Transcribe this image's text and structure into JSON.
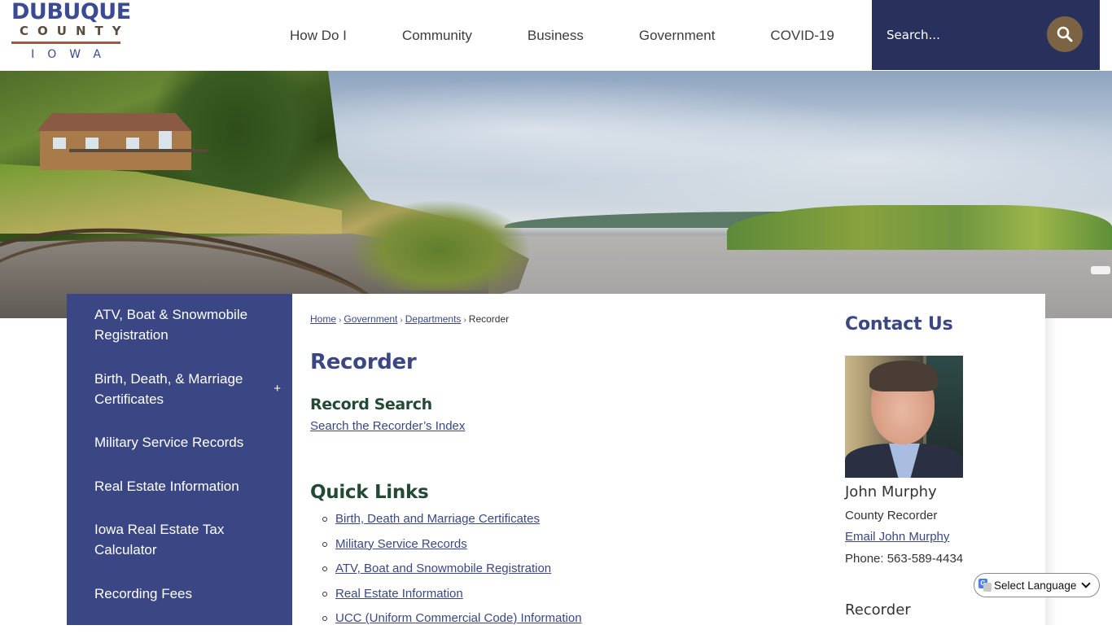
{
  "header": {
    "logo": {
      "line1": "DUBUQUE",
      "line2": "COUNTY",
      "line3": "IOWA"
    },
    "nav": [
      {
        "label": "How Do I"
      },
      {
        "label": "Community"
      },
      {
        "label": "Business"
      },
      {
        "label": "Government"
      },
      {
        "label": "COVID-19"
      }
    ],
    "search": {
      "placeholder": "Search...",
      "button_icon": "search-icon"
    }
  },
  "sidebar": {
    "items": [
      {
        "label": "ATV, Boat & Snowmobile Registration",
        "expandable": false
      },
      {
        "label": "Birth, Death, & Marriage Certificates",
        "expandable": true,
        "expand_symbol": "+"
      },
      {
        "label": "Military Service Records",
        "expandable": false
      },
      {
        "label": "Real Estate Information",
        "expandable": false
      },
      {
        "label": "Iowa Real Estate Tax Calculator",
        "expandable": false
      },
      {
        "label": "Recording Fees",
        "expandable": false
      }
    ]
  },
  "breadcrumb": {
    "items": [
      {
        "label": "Home",
        "link": true
      },
      {
        "label": "Government",
        "link": true
      },
      {
        "label": "Departments",
        "link": true
      },
      {
        "label": "Recorder",
        "link": false
      }
    ],
    "separator": "›"
  },
  "main": {
    "title": "Recorder",
    "record_search": {
      "heading": "Record Search",
      "link": "Search the Recorder’s Index"
    },
    "quick_links": {
      "heading": "Quick Links",
      "items": [
        "Birth, Death and Marriage Certificates",
        "Military Service Records",
        "ATV, Boat and Snowmobile Registration",
        "Real Estate Information",
        "UCC (Uniform Commercial Code) Information"
      ]
    }
  },
  "contact": {
    "heading": "Contact Us",
    "name": "John Murphy",
    "role": "County Recorder",
    "email_link": "Email John Murphy",
    "phone": "Phone: 563-589-4434",
    "sub_heading": "Recorder"
  },
  "translate": {
    "label": "Select Language"
  },
  "colors": {
    "brand_blue": "#3a4784",
    "header_search_bg": "#28305c",
    "search_button": "#7b6344",
    "heading_green": "#234a35",
    "logo_brown": "#5b4d3e",
    "logo_rule": "#9a5a45"
  }
}
